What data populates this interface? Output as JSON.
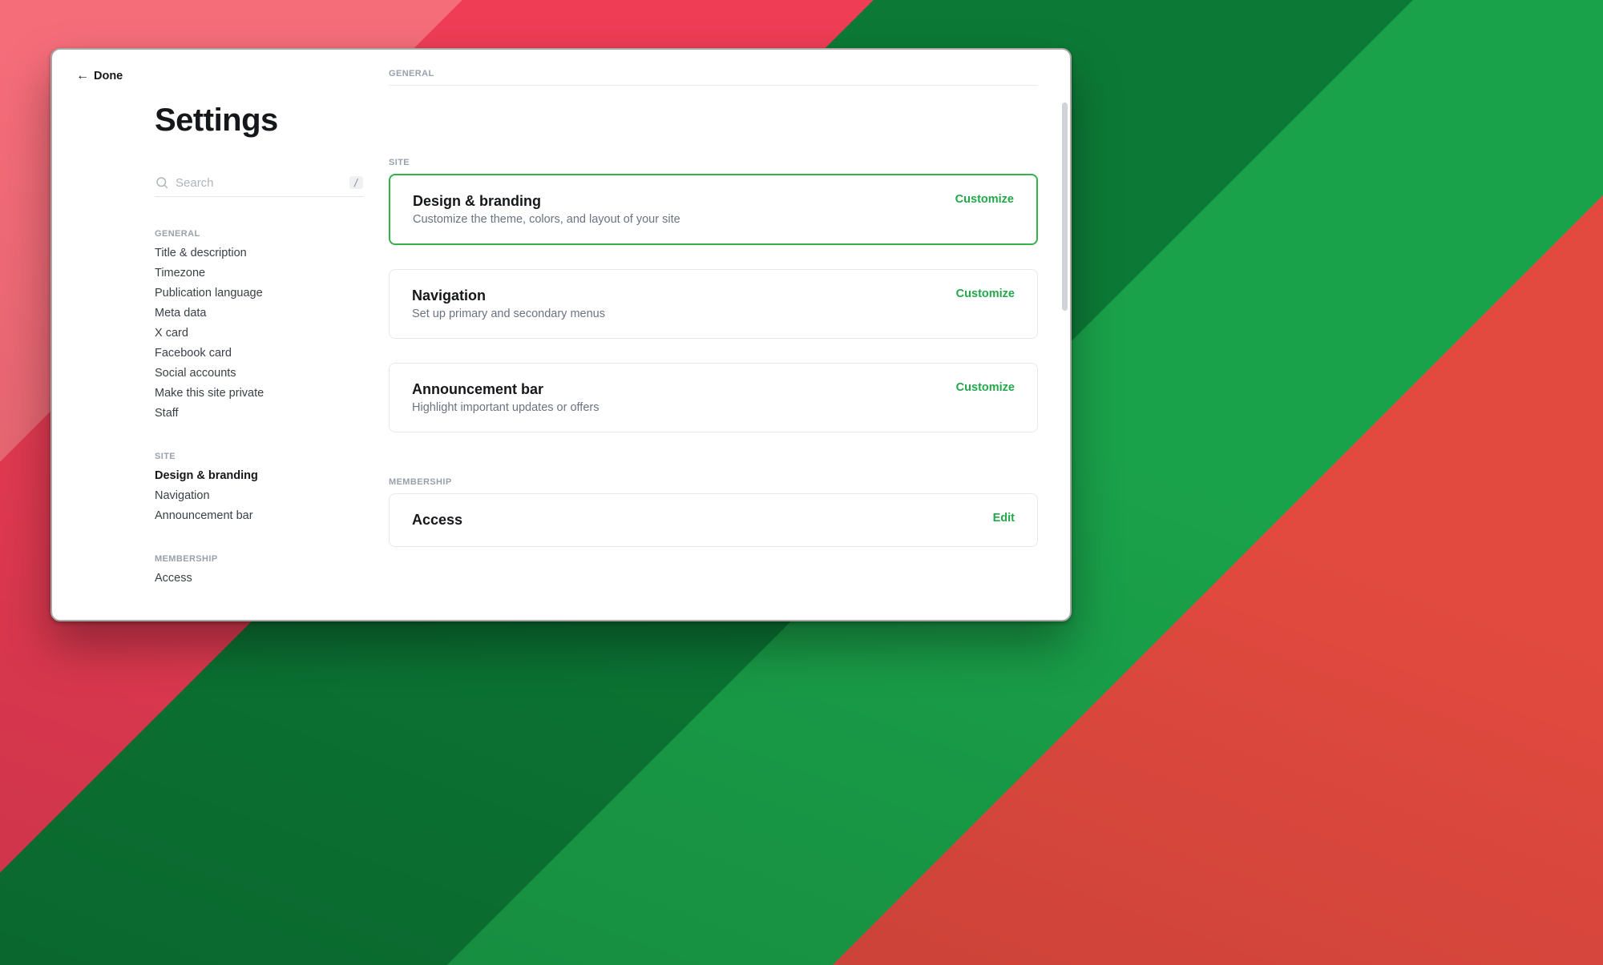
{
  "header": {
    "back_label": "Done",
    "page_title": "Settings"
  },
  "search": {
    "placeholder": "Search",
    "shortcut": "/"
  },
  "sidebar": {
    "sections": [
      {
        "label": "GENERAL",
        "items": [
          {
            "name": "title-description",
            "label": "Title & description",
            "active": false
          },
          {
            "name": "timezone",
            "label": "Timezone",
            "active": false
          },
          {
            "name": "publication-language",
            "label": "Publication language",
            "active": false
          },
          {
            "name": "meta-data",
            "label": "Meta data",
            "active": false
          },
          {
            "name": "x-card",
            "label": "X card",
            "active": false
          },
          {
            "name": "facebook-card",
            "label": "Facebook card",
            "active": false
          },
          {
            "name": "social-accounts",
            "label": "Social accounts",
            "active": false
          },
          {
            "name": "make-site-private",
            "label": "Make this site private",
            "active": false
          },
          {
            "name": "staff",
            "label": "Staff",
            "active": false
          }
        ]
      },
      {
        "label": "SITE",
        "items": [
          {
            "name": "design-branding",
            "label": "Design & branding",
            "active": true
          },
          {
            "name": "navigation",
            "label": "Navigation",
            "active": false
          },
          {
            "name": "announcement-bar",
            "label": "Announcement bar",
            "active": false
          }
        ]
      },
      {
        "label": "MEMBERSHIP",
        "items": [
          {
            "name": "access",
            "label": "Access",
            "active": false
          }
        ]
      }
    ]
  },
  "main": {
    "sections": [
      {
        "label": "GENERAL",
        "cards": []
      },
      {
        "label": "SITE",
        "cards": [
          {
            "name": "design-branding-card",
            "title": "Design & branding",
            "description": "Customize the theme, colors, and layout of your site",
            "action": "Customize",
            "highlight": true
          },
          {
            "name": "navigation-card",
            "title": "Navigation",
            "description": "Set up primary and secondary menus",
            "action": "Customize",
            "highlight": false
          },
          {
            "name": "announcement-bar-card",
            "title": "Announcement bar",
            "description": "Highlight important updates or offers",
            "action": "Customize",
            "highlight": false
          }
        ]
      },
      {
        "label": "MEMBERSHIP",
        "cards": [
          {
            "name": "access-card",
            "title": "Access",
            "description": "",
            "action": "Edit",
            "highlight": false
          }
        ]
      }
    ]
  },
  "colors": {
    "accent": "#22a84a",
    "highlight_border": "#33b24a"
  }
}
